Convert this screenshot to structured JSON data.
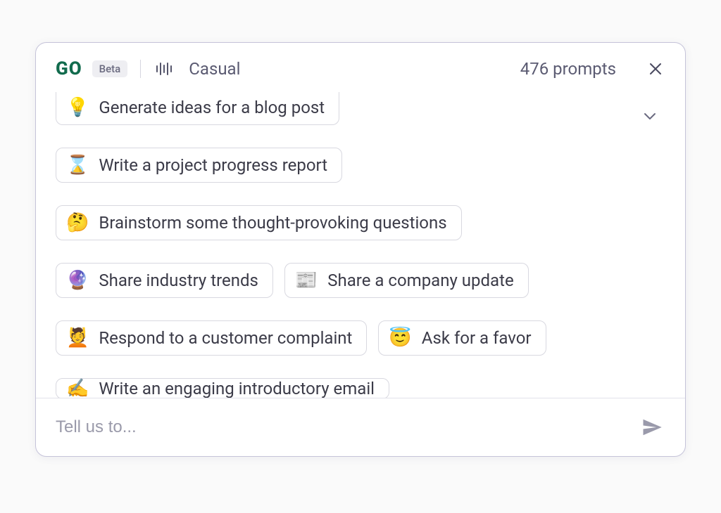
{
  "header": {
    "logo": "GO",
    "beta_label": "Beta",
    "mode": "Casual",
    "prompts_count": "476 prompts"
  },
  "suggestions": [
    {
      "emoji": "💡",
      "label": "Generate ideas for a blog post"
    },
    {
      "emoji": "⌛",
      "label": "Write a project progress report"
    },
    {
      "emoji": "🤔",
      "label": "Brainstorm some thought-provoking questions"
    },
    {
      "emoji": "🔮",
      "label": "Share industry trends"
    },
    {
      "emoji": "📰",
      "label": "Share a company update"
    },
    {
      "emoji": "💆",
      "label": "Respond to a customer complaint"
    },
    {
      "emoji": "😇",
      "label": "Ask for a favor"
    },
    {
      "emoji": "✍️",
      "label": "Write an engaging introductory email"
    }
  ],
  "input": {
    "placeholder": "Tell us to..."
  }
}
